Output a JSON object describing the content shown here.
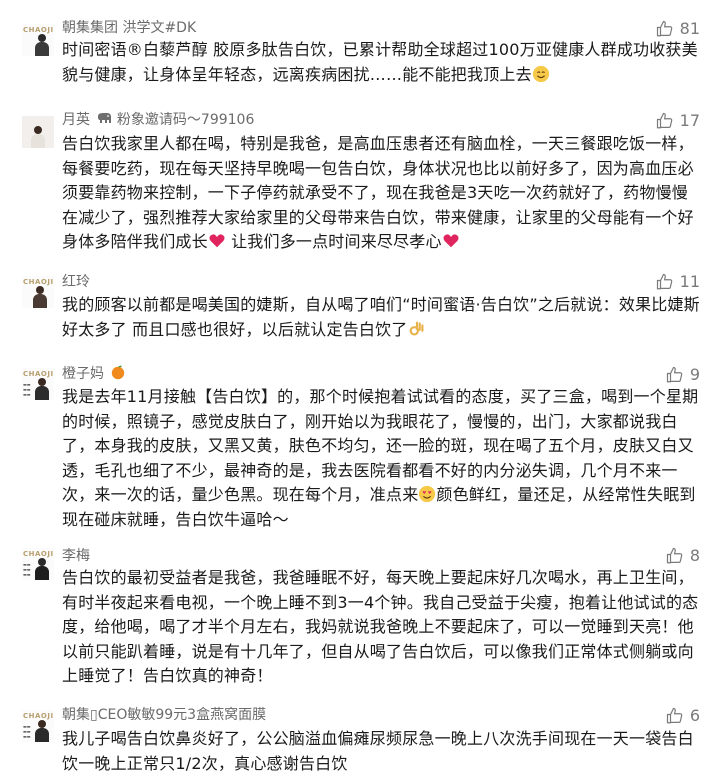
{
  "comments": [
    {
      "nickname": "朝集集团 洪学文#DK",
      "likes": "81",
      "text": "时间密语®白藜芦醇 胶原多肽告白饮，已累计帮助全球超过100万亚健康人群成功收获美貌与健康，让身体呈年轻态，远离疾病困扰……能不能把我顶上去",
      "avatar_brand": "CHAOJI"
    },
    {
      "nickname": "月英",
      "nickname_suffix": "粉象邀请码～799106",
      "likes": "17",
      "text_a": "告白饮我家里人都在喝，特别是我爸，是高血压患者还有脑血栓，一天三餐跟吃饭一样，每餐要吃药，现在每天坚持早晚喝一包告白饮，身体状况也比以前好多了，因为高血压必须要靠药物来控制，一下子停药就承受不了，现在我爸是3天吃一次药就好了，药物慢慢在减少了，强烈推荐大家给家里的父母带来告白饮，带来健康，让家里的父母能有一个好身体多陪伴我们成长",
      "text_b": "让我们多一点时间来尽尽孝心"
    },
    {
      "nickname": "红玲",
      "likes": "11",
      "text": "我的顾客以前都是喝美国的婕斯，自从喝了咱们“时间蜜语·告白饮”之后就说：效果比婕斯好太多了 而且口感也很好，以后就认定告白饮了",
      "avatar_brand": "CHAOJI"
    },
    {
      "nickname": "橙子妈",
      "likes": "9",
      "text_a": "我是去年11月接触【告白饮】的，那个时候抱着试试看的态度，买了三盒，喝到一个星期的时候，照镜子，感觉皮肤白了，刚开始以为我眼花了，慢慢的，出门，大家都说我白了，本身我的皮肤，又黑又黄，肤色不均匀，还一脸的斑，现在喝了五个月，皮肤又白又透，毛孔也细了不少，最神奇的是，我去医院看都看不好的内分泌失调，几个月不来一次，来一次的话，量少色黑。现在每个月，准点来",
      "text_b": "颜色鲜红，量还足，从经常性失眠到现在碰床就睡，告白饮牛逼哈～",
      "avatar_brand": "CHAOJI"
    },
    {
      "nickname": "李梅",
      "likes": "8",
      "text": "告白饮的最初受益者是我爸，我爸睡眠不好，每天晚上要起床好几次喝水，再上卫生间，有时半夜起来看电视，一个晚上睡不到3一4个钟。我自己受益于尖瘦，抱着让他试试的态度，给他喝，喝了才半个月左右，我妈就说我爸晚上不要起床了，可以一觉睡到天亮！他以前只能趴着睡，说是有十几年了，但自从喝了告白饮后，可以像我们正常体式侧躺或向上睡觉了！告白饮真的神奇！",
      "avatar_brand": "CHAOJI"
    },
    {
      "nickname": "朝集▯CEO敏敏99元3盒燕窝面膜",
      "likes": "6",
      "text": "我儿子喝告白饮鼻炎好了，公公脑溢血偏瘫尿频尿急一晚上八次洗手间现在一天一袋告白饮一晚上正常只1/2次，真心感谢告白饮",
      "avatar_brand": "CHAOJI"
    }
  ],
  "icons": {
    "like": "thumbs-up-icon",
    "smile": "smiling-face-emoji",
    "heart": "red-heart-emoji",
    "ok": "ok-hand-emoji",
    "orange": "tangerine-emoji",
    "elephant": "elephant-icon",
    "blush": "smiling-face-with-heart-eyes-emoji"
  },
  "colors": {
    "nickname": "#6b6b6b",
    "like_count": "#7a7a7a",
    "heart": "#e0245e",
    "brand": "#b8a070"
  }
}
